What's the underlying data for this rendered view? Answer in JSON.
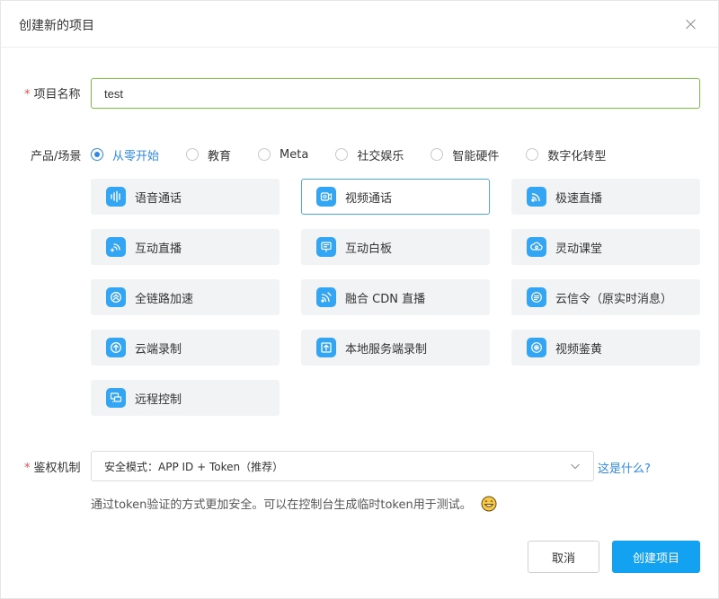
{
  "dialog": {
    "title": "创建新的项目"
  },
  "form": {
    "name_label": "项目名称",
    "required_mark": "*",
    "name_value": "test",
    "scene_label": "产品/场景",
    "scenes": [
      {
        "label": "从零开始",
        "active": true
      },
      {
        "label": "教育",
        "active": false
      },
      {
        "label": "Meta",
        "active": false
      },
      {
        "label": "社交娱乐",
        "active": false
      },
      {
        "label": "智能硬件",
        "active": false
      },
      {
        "label": "数字化转型",
        "active": false
      }
    ],
    "products": [
      {
        "label": "语音通话",
        "icon": "voice-wave-icon"
      },
      {
        "label": "视频通话",
        "icon": "video-camera-icon",
        "selected": true
      },
      {
        "label": "极速直播",
        "icon": "broadcast-icon"
      },
      {
        "label": "互动直播",
        "icon": "interactive-live-icon"
      },
      {
        "label": "互动白板",
        "icon": "whiteboard-icon"
      },
      {
        "label": "灵动课堂",
        "icon": "classroom-icon"
      },
      {
        "label": "全链路加速",
        "icon": "acceleration-icon"
      },
      {
        "label": "融合 CDN 直播",
        "icon": "cdn-live-icon"
      },
      {
        "label": "云信令（原实时消息）",
        "icon": "message-icon"
      },
      {
        "label": "云端录制",
        "icon": "cloud-record-icon"
      },
      {
        "label": "本地服务端录制",
        "icon": "local-record-icon"
      },
      {
        "label": "视频鉴黄",
        "icon": "content-moderation-icon"
      },
      {
        "label": "远程控制",
        "icon": "remote-control-icon"
      }
    ],
    "auth_label": "鉴权机制",
    "auth_value": "安全模式：APP ID + Token（推荐）",
    "auth_help": "这是什么?",
    "auth_hint": "通过token验证的方式更加安全。可以在控制台生成临时token用于测试。"
  },
  "footer": {
    "cancel_label": "取消",
    "create_label": "创建项目"
  },
  "colors": {
    "accent": "#2f88e8",
    "primary_button": "#13a2f2",
    "input_focus": "#7ac142",
    "icon_bg": "#33a5f2"
  }
}
